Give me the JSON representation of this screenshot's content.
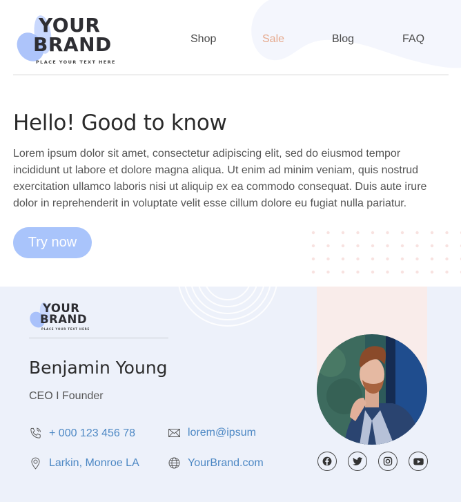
{
  "brand": {
    "line1": "YOUR",
    "line2": "BRAND",
    "tagline": "PLACE YOUR TEXT HERE"
  },
  "nav": {
    "items": [
      {
        "label": "Shop"
      },
      {
        "label": "Sale"
      },
      {
        "label": "Blog"
      },
      {
        "label": "FAQ"
      }
    ],
    "active_color": "#e6a98d"
  },
  "hero": {
    "title": "Hello! Good to know",
    "body": "Lorem ipsum dolor sit amet, consectetur adipiscing elit, sed do eiusmod tempor incididunt ut labore et dolore magna aliqua. Ut enim ad minim veniam, quis nostrud exercitation ullamco laboris nisi ut aliquip ex ea commodo consequat. Duis aute irure dolor in reprehenderit in voluptate velit esse cillum dolore eu fugiat nulla pariatur.",
    "cta_label": "Try now",
    "cta_color": "#a9c4fb"
  },
  "card": {
    "name": "Benjamin Young",
    "role": "CEO I Founder",
    "contacts": {
      "phone": {
        "icon": "phone-icon",
        "value": "+ 000 123 456 78"
      },
      "email": {
        "icon": "mail-icon",
        "value": "lorem@ipsum"
      },
      "address": {
        "icon": "location-pin-icon",
        "value": "Larkin, Monroe LA"
      },
      "website": {
        "icon": "globe-icon",
        "value": "YourBrand.com"
      }
    },
    "link_color": "#4d88c4",
    "photo_alt": "Portrait of Benjamin Young",
    "social": [
      {
        "name": "facebook-icon"
      },
      {
        "name": "twitter-icon"
      },
      {
        "name": "instagram-icon"
      },
      {
        "name": "youtube-icon"
      }
    ]
  }
}
